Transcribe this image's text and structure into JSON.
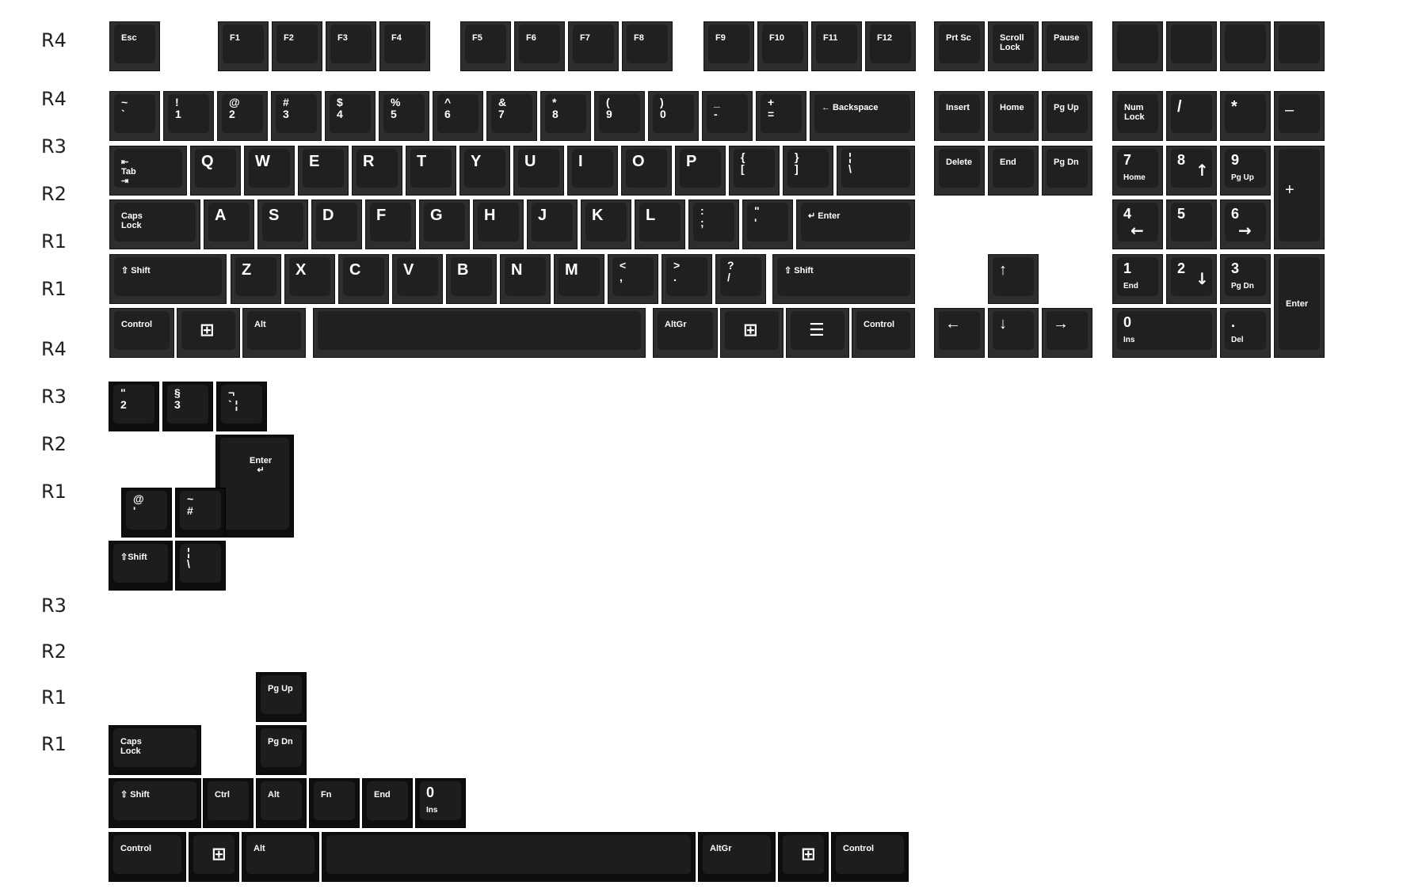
{
  "row_labels": [
    "R4",
    "R4",
    "R3",
    "R2",
    "R1",
    "R1",
    "R4",
    "R3",
    "R2",
    "R1",
    "R3",
    "R2",
    "R1",
    "R1"
  ],
  "keys": [
    {
      "id": "esc",
      "label": "Esc",
      "style": "small"
    },
    {
      "id": "f1",
      "label": "F1",
      "style": "small"
    },
    {
      "id": "f2",
      "label": "F2",
      "style": "small"
    },
    {
      "id": "f3",
      "label": "F3",
      "style": "small"
    },
    {
      "id": "f4",
      "label": "F4",
      "style": "small"
    },
    {
      "id": "f5",
      "label": "F5",
      "style": "small"
    },
    {
      "id": "f6",
      "label": "F6",
      "style": "small"
    },
    {
      "id": "f7",
      "label": "F7",
      "style": "small"
    },
    {
      "id": "f8",
      "label": "F8",
      "style": "small"
    },
    {
      "id": "f9",
      "label": "F9",
      "style": "small"
    },
    {
      "id": "f10",
      "label": "F10",
      "style": "small"
    },
    {
      "id": "f11",
      "label": "F11",
      "style": "small"
    },
    {
      "id": "f12",
      "label": "F12",
      "style": "small"
    },
    {
      "id": "prtsc",
      "label": "Prt Sc",
      "style": "small"
    },
    {
      "id": "scroll",
      "label": "Scroll\nLock",
      "style": "small"
    },
    {
      "id": "pause",
      "label": "Pause",
      "style": "small"
    },
    {
      "id": "blank1",
      "label": "",
      "style": "small"
    },
    {
      "id": "blank2",
      "label": "",
      "style": "small"
    },
    {
      "id": "blank3",
      "label": "",
      "style": "small"
    },
    {
      "id": "blank4",
      "label": "",
      "style": "small"
    },
    {
      "id": "tilde",
      "label": "~\n`",
      "style": "stack"
    },
    {
      "id": "k1",
      "label": "!\n1",
      "style": "stack"
    },
    {
      "id": "k2",
      "label": "@\n2",
      "style": "stack"
    },
    {
      "id": "k3",
      "label": "#\n3",
      "style": "stack"
    },
    {
      "id": "k4",
      "label": "$\n4",
      "style": "stack"
    },
    {
      "id": "k5",
      "label": "%\n5",
      "style": "stack"
    },
    {
      "id": "k6",
      "label": "^\n6",
      "style": "stack"
    },
    {
      "id": "k7",
      "label": "&\n7",
      "style": "stack"
    },
    {
      "id": "k8",
      "label": "*\n8",
      "style": "stack"
    },
    {
      "id": "k9",
      "label": "(\n9",
      "style": "stack"
    },
    {
      "id": "k0",
      "label": ")\n0",
      "style": "stack"
    },
    {
      "id": "minus",
      "label": "_\n-",
      "style": "stack"
    },
    {
      "id": "equal",
      "label": "+\n=",
      "style": "stack"
    },
    {
      "id": "backspace",
      "label": "← Backspace",
      "style": "small"
    },
    {
      "id": "insert",
      "label": "Insert",
      "style": "small"
    },
    {
      "id": "home",
      "label": "Home",
      "style": "small"
    },
    {
      "id": "pgup",
      "label": "Pg Up",
      "style": "small"
    },
    {
      "id": "numlock",
      "label": "Num\nLock",
      "style": "small"
    },
    {
      "id": "npslash",
      "label": "/",
      "style": "letter"
    },
    {
      "id": "npstar",
      "label": "*",
      "style": "letter"
    },
    {
      "id": "npminus",
      "label": "–",
      "style": "letter"
    },
    {
      "id": "tab",
      "label": "⇤\nTab\n⇥",
      "style": "small"
    },
    {
      "id": "q",
      "label": "Q",
      "style": "letter"
    },
    {
      "id": "w",
      "label": "W",
      "style": "letter"
    },
    {
      "id": "e",
      "label": "E",
      "style": "letter"
    },
    {
      "id": "r",
      "label": "R",
      "style": "letter"
    },
    {
      "id": "t",
      "label": "T",
      "style": "letter"
    },
    {
      "id": "y",
      "label": "Y",
      "style": "letter"
    },
    {
      "id": "u",
      "label": "U",
      "style": "letter"
    },
    {
      "id": "i",
      "label": "I",
      "style": "letter"
    },
    {
      "id": "o",
      "label": "O",
      "style": "letter"
    },
    {
      "id": "p",
      "label": "P",
      "style": "letter"
    },
    {
      "id": "lbracket",
      "label": "{\n[",
      "style": "stack"
    },
    {
      "id": "rbracket",
      "label": "}\n]",
      "style": "stack"
    },
    {
      "id": "backslash",
      "label": "¦\n\\",
      "style": "stack"
    },
    {
      "id": "delete",
      "label": "Delete",
      "style": "small"
    },
    {
      "id": "end",
      "label": "End",
      "style": "small"
    },
    {
      "id": "pgdn",
      "label": "Pg Dn",
      "style": "small"
    },
    {
      "id": "np7",
      "label": "7\nHome",
      "style": "numpad"
    },
    {
      "id": "np8",
      "label": "8",
      "style": "numpad",
      "arrow": "↑"
    },
    {
      "id": "np9",
      "label": "9\nPg Up",
      "style": "numpad"
    },
    {
      "id": "npplus",
      "label": "+",
      "style": "letter"
    },
    {
      "id": "caps",
      "label": "Caps\nLock",
      "style": "small"
    },
    {
      "id": "a",
      "label": "A",
      "style": "letter"
    },
    {
      "id": "s",
      "label": "S",
      "style": "letter"
    },
    {
      "id": "d",
      "label": "D",
      "style": "letter"
    },
    {
      "id": "f",
      "label": "F",
      "style": "letter"
    },
    {
      "id": "g",
      "label": "G",
      "style": "letter"
    },
    {
      "id": "h",
      "label": "H",
      "style": "letter"
    },
    {
      "id": "j",
      "label": "J",
      "style": "letter"
    },
    {
      "id": "k",
      "label": "K",
      "style": "letter"
    },
    {
      "id": "l",
      "label": "L",
      "style": "letter"
    },
    {
      "id": "semicolon",
      "label": ":\n;",
      "style": "stack"
    },
    {
      "id": "quote",
      "label": "\"\n'",
      "style": "stack"
    },
    {
      "id": "enter",
      "label": "↵ Enter",
      "style": "small"
    },
    {
      "id": "np4",
      "label": "4",
      "style": "numpad",
      "arrow": "←"
    },
    {
      "id": "np5",
      "label": "5",
      "style": "numpad"
    },
    {
      "id": "np6",
      "label": "6",
      "style": "numpad",
      "arrow": "→"
    },
    {
      "id": "lshift",
      "label": "⇧ Shift",
      "style": "small"
    },
    {
      "id": "z",
      "label": "Z",
      "style": "letter"
    },
    {
      "id": "x",
      "label": "X",
      "style": "letter"
    },
    {
      "id": "c",
      "label": "C",
      "style": "letter"
    },
    {
      "id": "v",
      "label": "V",
      "style": "letter"
    },
    {
      "id": "b",
      "label": "B",
      "style": "letter"
    },
    {
      "id": "n",
      "label": "N",
      "style": "letter"
    },
    {
      "id": "m",
      "label": "M",
      "style": "letter"
    },
    {
      "id": "comma",
      "label": "<\n,",
      "style": "stack"
    },
    {
      "id": "period",
      "label": ">\n.",
      "style": "stack"
    },
    {
      "id": "slash",
      "label": "?\n/",
      "style": "stack"
    },
    {
      "id": "rshift",
      "label": "⇧ Shift",
      "style": "small"
    },
    {
      "id": "up",
      "label": "↑",
      "style": "letter"
    },
    {
      "id": "np1",
      "label": "1\nEnd",
      "style": "numpad"
    },
    {
      "id": "np2",
      "label": "2",
      "style": "numpad",
      "arrow": "↓"
    },
    {
      "id": "np3",
      "label": "3\nPg Dn",
      "style": "numpad"
    },
    {
      "id": "npenter",
      "label": "Enter",
      "style": "small"
    },
    {
      "id": "lctrl",
      "label": "Control",
      "style": "small"
    },
    {
      "id": "lwin",
      "label": "⊞",
      "style": "win"
    },
    {
      "id": "lalt",
      "label": "Alt",
      "style": "small"
    },
    {
      "id": "space",
      "label": "",
      "style": "small"
    },
    {
      "id": "altgr",
      "label": "AltGr",
      "style": "small"
    },
    {
      "id": "rwin",
      "label": "⊞",
      "style": "win"
    },
    {
      "id": "menu",
      "label": "☰",
      "style": "win"
    },
    {
      "id": "rctrl",
      "label": "Control",
      "style": "small"
    },
    {
      "id": "left",
      "label": "←",
      "style": "letter"
    },
    {
      "id": "down",
      "label": "↓",
      "style": "letter"
    },
    {
      "id": "right",
      "label": "→",
      "style": "letter"
    },
    {
      "id": "np0",
      "label": "0\nIns",
      "style": "numpad"
    },
    {
      "id": "npdot",
      "label": ".\nDel",
      "style": "numpad"
    },
    {
      "id": "iso2",
      "label": "\"\n2",
      "style": "stack"
    },
    {
      "id": "iso3",
      "label": "§\n3",
      "style": "stack"
    },
    {
      "id": "isotick",
      "label": "¬\n` ¦",
      "style": "stack"
    },
    {
      "id": "isoenter",
      "label": "Enter\n↵",
      "style": "small"
    },
    {
      "id": "isoat",
      "label": "@\n'",
      "style": "stack"
    },
    {
      "id": "isohash",
      "label": "~\n#",
      "style": "stack"
    },
    {
      "id": "isoshift",
      "label": "⇧Shift",
      "style": "small"
    },
    {
      "id": "isopipe",
      "label": "¦\n\\",
      "style": "stack"
    },
    {
      "id": "x_pgup",
      "label": "Pg Up",
      "style": "small"
    },
    {
      "id": "x_caps",
      "label": "Caps\nLock",
      "style": "small"
    },
    {
      "id": "x_pgdn",
      "label": "Pg Dn",
      "style": "small"
    },
    {
      "id": "x_shift",
      "label": "⇧ Shift",
      "style": "small"
    },
    {
      "id": "x_ctrl",
      "label": "Ctrl",
      "style": "small"
    },
    {
      "id": "x_alt",
      "label": "Alt",
      "style": "small"
    },
    {
      "id": "x_fn",
      "label": "Fn",
      "style": "small"
    },
    {
      "id": "x_end",
      "label": "End",
      "style": "small"
    },
    {
      "id": "x_ins",
      "label": "0\nIns",
      "style": "numpad"
    },
    {
      "id": "x_lctrl",
      "label": "Control",
      "style": "small"
    },
    {
      "id": "x_lwin",
      "label": "⊞",
      "style": "win"
    },
    {
      "id": "x_lalt",
      "label": "Alt",
      "style": "small"
    },
    {
      "id": "x_space",
      "label": "",
      "style": "small"
    },
    {
      "id": "x_altgr",
      "label": "AltGr",
      "style": "small"
    },
    {
      "id": "x_rwin",
      "label": "⊞",
      "style": "win"
    },
    {
      "id": "x_rctrl",
      "label": "Control",
      "style": "small"
    }
  ],
  "colors": {
    "key_body": "#2e2e2e",
    "key_top": "#202020",
    "dark_body": "#0e0e0e",
    "legend": "#ffffff",
    "label": "#222222"
  }
}
